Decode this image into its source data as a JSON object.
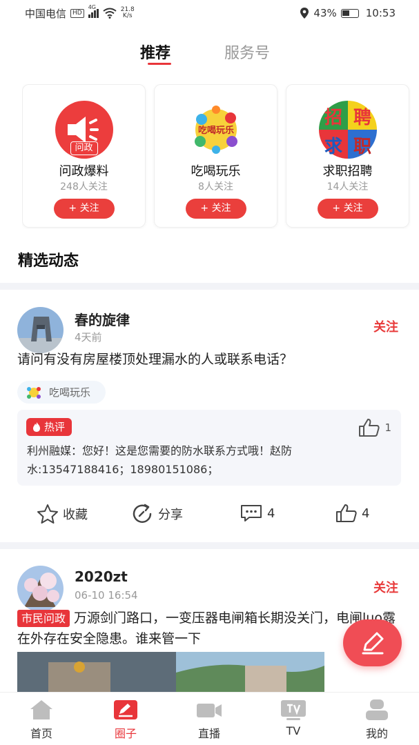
{
  "status_bar": {
    "carrier": "中国电信",
    "hd": "HD",
    "network": "4G",
    "speed_value": "21.8",
    "speed_unit": "K/s",
    "battery": "43%",
    "time": "10:53"
  },
  "tabs": [
    {
      "label": "推荐",
      "active": true
    },
    {
      "label": "服务号",
      "active": false
    }
  ],
  "circles": [
    {
      "name": "问政爆料",
      "followers": "248人关注",
      "badge": "问政",
      "follow_label": "+ 关注"
    },
    {
      "name": "吃喝玩乐",
      "followers": "8人关注",
      "logo_text": "吃喝玩乐",
      "follow_label": "+ 关注"
    },
    {
      "name": "求职招聘",
      "followers": "14人关注",
      "logo_chars": [
        "招",
        "聘",
        "求",
        "职"
      ],
      "follow_label": "+ 关注"
    }
  ],
  "section_title": "精选动态",
  "posts": [
    {
      "username": "春的旋律",
      "time": "4天前",
      "follow_label": "关注",
      "text": "请问有没有房屋楼顶处理漏水的人或联系电话？",
      "circle_tag": "吃喝玩乐",
      "hot_comment": {
        "badge": "热评",
        "likes": "1",
        "text": "利州融媒：您好！这是您需要的防水联系方式哦！赵防水:13547188416；18980151086；"
      },
      "actions": {
        "favorite": "收藏",
        "share": "分享",
        "comments": "4",
        "likes": "4"
      }
    },
    {
      "username": "2020zt",
      "time": "06-10 16:54",
      "follow_label": "关注",
      "tag": "市民问政",
      "text": "万源剑门路口，一变压器电闸箱长期没关门，电闸luo露在外存在安全隐患。谁来管一下"
    }
  ],
  "bottom_nav": [
    {
      "label": "首页",
      "icon": "home-icon",
      "active": false
    },
    {
      "label": "圈子",
      "icon": "circle-icon",
      "active": true
    },
    {
      "label": "直播",
      "icon": "video-camera-icon",
      "active": false
    },
    {
      "label": "TV",
      "icon": "tv-icon",
      "active": false
    },
    {
      "label": "我的",
      "icon": "user-icon",
      "active": false
    }
  ],
  "colors": {
    "accent": "#e8353a",
    "follow_button": "#ea3f3c",
    "fab": "#f04d55",
    "divider": "#f2f3f7"
  }
}
